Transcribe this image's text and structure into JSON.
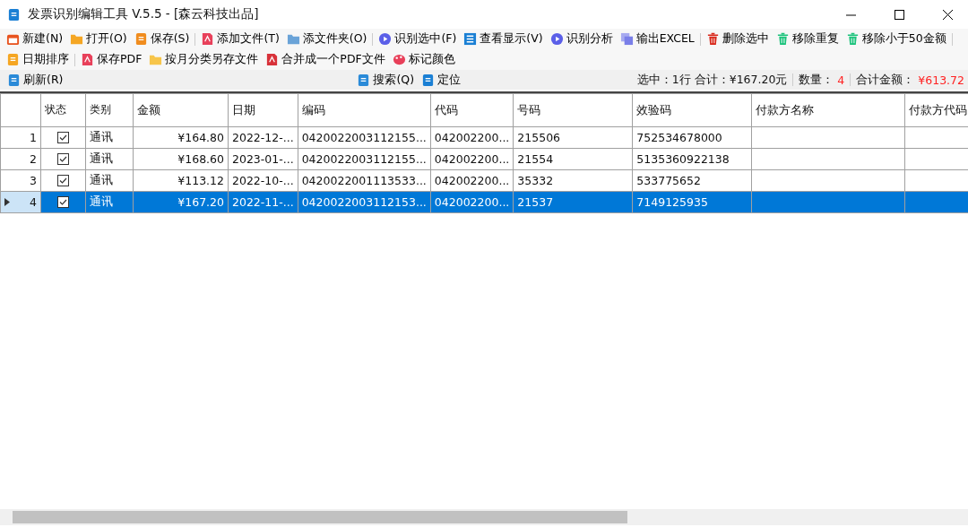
{
  "window": {
    "title": "发票识别编辑工具 V.5.5 - [森云科技出品]"
  },
  "toolbar_rows": [
    {
      "items": [
        "新建(N)",
        "打开(O)",
        "保存(S)",
        "添加文件(T)",
        "添文件夹(O)",
        "识别选中(F)",
        "查看显示(V)",
        "识别分析",
        "输出EXCEL",
        "删除选中",
        "移除重复",
        "移除小于50金额"
      ]
    },
    {
      "items": [
        "日期排序",
        "保存PDF",
        "按月分类另存文件",
        "合并成一个PDF文件",
        "标记颜色"
      ]
    }
  ],
  "search_bar": {
    "refresh": "刷新(R)",
    "search": "搜索(Q)",
    "locate": "定位"
  },
  "summary": {
    "selection": "选中：1行 合计：¥167.20元",
    "count_label": "数量：",
    "count": "4",
    "total_label": "合计金额：",
    "total": "¥613.72"
  },
  "table": {
    "columns": [
      "状态",
      "类别",
      "金额",
      "日期",
      "编码",
      "代码",
      "号码",
      "效验码",
      "付款方名称",
      "付款方代码"
    ],
    "rows": [
      {
        "index": "1",
        "checked": true,
        "selected": false,
        "cells": [
          "",
          "通讯",
          "¥164.80",
          "2022-12-...",
          "0420022003112155...",
          "042002200...",
          "215506",
          "752534678000",
          "",
          ""
        ]
      },
      {
        "index": "2",
        "checked": true,
        "selected": false,
        "cells": [
          "",
          "通讯",
          "¥168.60",
          "2023-01-...",
          "0420022003112155...",
          "042002200...",
          "21554",
          "5135360922138",
          "",
          ""
        ]
      },
      {
        "index": "3",
        "checked": true,
        "selected": false,
        "cells": [
          "",
          "通讯",
          "¥113.12",
          "2022-10-...",
          "0420022001113533...",
          "042002200...",
          "35332",
          "533775652",
          "",
          ""
        ]
      },
      {
        "index": "4",
        "checked": true,
        "selected": true,
        "cells": [
          "",
          "通讯",
          "¥167.20",
          "2022-11-...",
          "0420022003112153...",
          "042002200...",
          "21537",
          "7149125935",
          "",
          ""
        ]
      }
    ]
  }
}
